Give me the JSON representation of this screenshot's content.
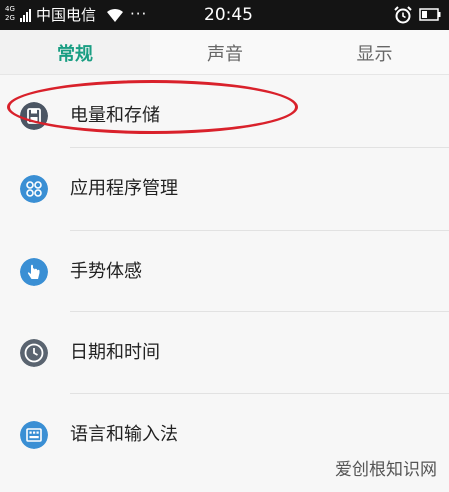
{
  "status_bar": {
    "network_top": "4G",
    "network_bottom": "2G",
    "carrier": "中国电信",
    "overflow": "···",
    "time": "20:45",
    "icons": [
      "signal-icon",
      "wifi-icon",
      "alarm-icon",
      "battery-icon"
    ]
  },
  "tabs": [
    {
      "label": "常规",
      "active": true
    },
    {
      "label": "声音",
      "active": false
    },
    {
      "label": "显示",
      "active": false
    }
  ],
  "settings_items": [
    {
      "label": "电量和存储",
      "icon": "storage-icon",
      "highlighted": true
    },
    {
      "label": "应用程序管理",
      "icon": "apps-icon"
    },
    {
      "label": "手势体感",
      "icon": "gesture-icon"
    },
    {
      "label": "日期和时间",
      "icon": "clock-icon"
    },
    {
      "label": "语言和输入法",
      "icon": "language-icon"
    }
  ],
  "watermark": "爱创根知识网",
  "colors": {
    "accent": "#1a9e83",
    "icon_blue": "#3a8fd4",
    "clock_gray": "#5a6470",
    "highlight_red": "#d9212b"
  }
}
